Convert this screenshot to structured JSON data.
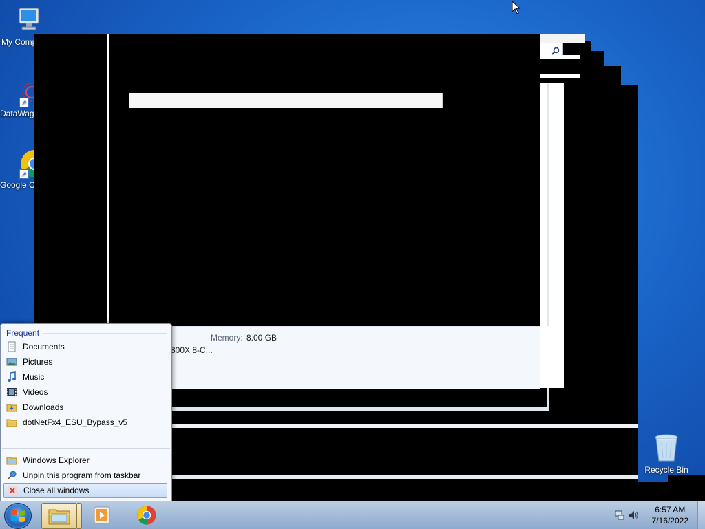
{
  "desktop": {
    "icons": [
      {
        "label": "My Comp",
        "icon": "computer-icon"
      },
      {
        "label": "DataWag",
        "icon": "datawag-app-icon"
      },
      {
        "label": "Google C",
        "icon": "chrome-icon"
      },
      {
        "label": "Recycle Bin",
        "icon": "recycle-bin-icon"
      }
    ]
  },
  "window": {
    "memory_label": "Memory:",
    "memory_value": "8.00 GB",
    "processor_text": "800X 8-C..."
  },
  "jumplist": {
    "heading": "Frequent",
    "frequent_items": [
      {
        "label": "Documents",
        "icon": "documents-icon"
      },
      {
        "label": "Pictures",
        "icon": "pictures-icon"
      },
      {
        "label": "Music",
        "icon": "music-icon"
      },
      {
        "label": "Videos",
        "icon": "videos-icon"
      },
      {
        "label": "Downloads",
        "icon": "downloads-folder-icon"
      },
      {
        "label": "dotNetFx4_ESU_Bypass_v5",
        "icon": "folder-icon"
      }
    ],
    "tasks": [
      {
        "label": "Windows Explorer",
        "icon": "explorer-icon"
      },
      {
        "label": "Unpin this program from taskbar",
        "icon": "unpin-icon"
      },
      {
        "label": "Close all windows",
        "icon": "close-windows-icon"
      }
    ]
  },
  "taskbar": {
    "pinned": [
      {
        "name": "Windows Explorer",
        "icon": "explorer-icon",
        "active": true
      },
      {
        "name": "Media Player",
        "icon": "media-player-icon",
        "active": false
      },
      {
        "name": "Google Chrome",
        "icon": "chrome-icon",
        "active": false
      }
    ],
    "clock_time": "6:57 AM",
    "clock_date": "7/16/2022"
  },
  "colors": {
    "desktop_blue": "#1a64c8",
    "jumplist_heading": "#1e3287",
    "selection": "#c8ddf6"
  }
}
